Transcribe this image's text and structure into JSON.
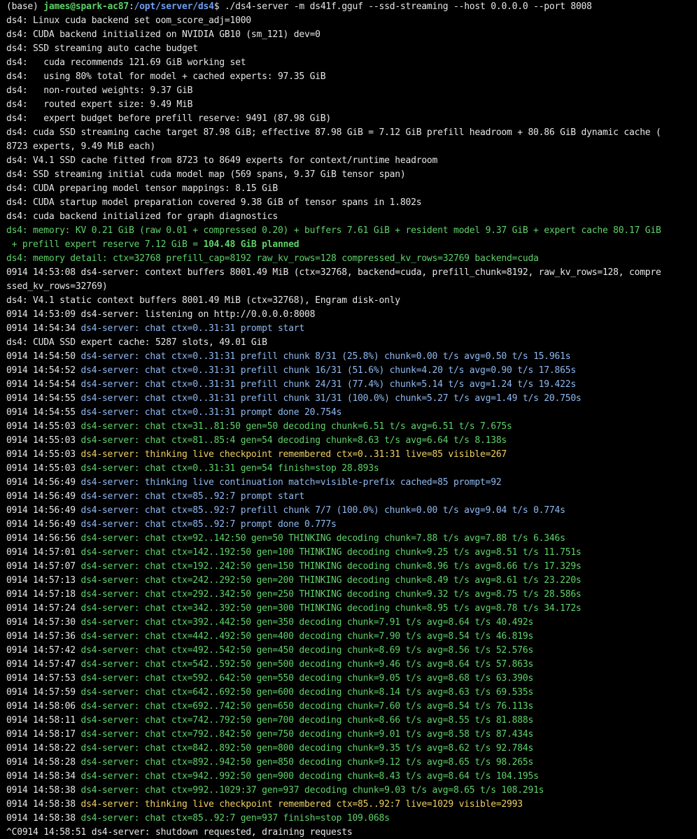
{
  "colors": {
    "background": "#000000",
    "default": "#e6e6e6",
    "blue": "#8fb8f0",
    "green": "#5fd16a",
    "yellow": "#f0d060",
    "prompt_user": "#5fd16a",
    "prompt_path": "#6f9ff0"
  },
  "lines": [
    [
      [
        "default",
        "(base) "
      ],
      [
        "prompt-user",
        "james@spark-ac87"
      ],
      [
        "default",
        ":"
      ],
      [
        "prompt-path",
        "/opt/server/ds4"
      ],
      [
        "default",
        "$ ./ds4-server -m ds41f.gguf --ssd-streaming --host 0.0.0.0 --port 8008"
      ]
    ],
    [
      [
        "default",
        "ds4: Linux cuda backend set oom_score_adj=1000"
      ]
    ],
    [
      [
        "default",
        "ds4: CUDA backend initialized on NVIDIA GB10 (sm_121) dev=0"
      ]
    ],
    [
      [
        "default",
        "ds4: SSD streaming auto cache budget"
      ]
    ],
    [
      [
        "default",
        "ds4:   cuda recommends 121.69 GiB working set"
      ]
    ],
    [
      [
        "default",
        "ds4:   using 80% total for model + cached experts: 97.35 GiB"
      ]
    ],
    [
      [
        "default",
        "ds4:   non-routed weights: 9.37 GiB"
      ]
    ],
    [
      [
        "default",
        "ds4:   routed expert size: 9.49 MiB"
      ]
    ],
    [
      [
        "default",
        "ds4:   expert budget before prefill reserve: 9491 (87.98 GiB)"
      ]
    ],
    [
      [
        "default",
        "ds4: cuda SSD streaming cache target 87.98 GiB; effective 87.98 GiB = 7.12 GiB prefill headroom + 80.86 GiB dynamic cache ("
      ]
    ],
    [
      [
        "default",
        "8723 experts, 9.49 MiB each)"
      ]
    ],
    [
      [
        "default",
        "ds4: V4.1 SSD cache fitted from 8723 to 8649 experts for context/runtime headroom"
      ]
    ],
    [
      [
        "default",
        "ds4: SSD streaming initial cuda model map (569 spans, 9.37 GiB tensor span)"
      ]
    ],
    [
      [
        "default",
        "ds4: CUDA preparing model tensor mappings: 8.15 GiB"
      ]
    ],
    [
      [
        "default",
        "ds4: CUDA startup model preparation covered 9.38 GiB of tensor spans in 1.802s"
      ]
    ],
    [
      [
        "default",
        "ds4: cuda backend initialized for graph diagnostics"
      ]
    ],
    [
      [
        "green",
        "ds4: memory: KV 0.21 GiB (raw 0.01 + compressed 0.20) + buffers 7.61 GiB + resident model 9.37 GiB + expert cache 80.17 GiB"
      ]
    ],
    [
      [
        "green",
        " + prefill expert reserve 7.12 GiB = "
      ],
      [
        "green-bold",
        "104.48 GiB planned"
      ]
    ],
    [
      [
        "green",
        "ds4: memory detail: ctx=32768 prefill_cap=8192 raw_kv_rows=128 compressed_kv_rows=32769 backend=cuda"
      ]
    ],
    [
      [
        "default",
        "0914 14:53:08 ds4-server: context buffers 8001.49 MiB (ctx=32768, backend=cuda, prefill_chunk=8192, raw_kv_rows=128, compre"
      ]
    ],
    [
      [
        "default",
        "ssed_kv_rows=32769)"
      ]
    ],
    [
      [
        "default",
        "ds4: V4.1 static context buffers 8001.49 MiB (ctx=32768), Engram disk-only"
      ]
    ],
    [
      [
        "default",
        "0914 14:53:09 ds4-server: listening on http://0.0.0.0:8008"
      ]
    ],
    [
      [
        "default",
        "0914 14:54:34 "
      ],
      [
        "blue",
        "ds4-server: chat ctx=0..31:31 prompt start"
      ]
    ],
    [
      [
        "default",
        "ds4: CUDA SSD expert cache: 5287 slots, 49.01 GiB"
      ]
    ],
    [
      [
        "default",
        "0914 14:54:50 "
      ],
      [
        "blue",
        "ds4-server: chat ctx=0..31:31 prefill chunk 8/31 (25.8%) chunk=0.00 t/s avg=0.50 t/s 15.961s"
      ]
    ],
    [
      [
        "default",
        "0914 14:54:52 "
      ],
      [
        "blue",
        "ds4-server: chat ctx=0..31:31 prefill chunk 16/31 (51.6%) chunk=4.20 t/s avg=0.90 t/s 17.865s"
      ]
    ],
    [
      [
        "default",
        "0914 14:54:54 "
      ],
      [
        "blue",
        "ds4-server: chat ctx=0..31:31 prefill chunk 24/31 (77.4%) chunk=5.14 t/s avg=1.24 t/s 19.422s"
      ]
    ],
    [
      [
        "default",
        "0914 14:54:55 "
      ],
      [
        "blue",
        "ds4-server: chat ctx=0..31:31 prefill chunk 31/31 (100.0%) chunk=5.27 t/s avg=1.49 t/s 20.750s"
      ]
    ],
    [
      [
        "default",
        "0914 14:54:55 "
      ],
      [
        "blue",
        "ds4-server: chat ctx=0..31:31 prompt done 20.754s"
      ]
    ],
    [
      [
        "default",
        "0914 14:55:03 "
      ],
      [
        "green",
        "ds4-server: chat ctx=31..81:50 gen=50 decoding chunk=6.51 t/s avg=6.51 t/s 7.675s"
      ]
    ],
    [
      [
        "default",
        "0914 14:55:03 "
      ],
      [
        "green",
        "ds4-server: chat ctx=81..85:4 gen=54 decoding chunk=8.63 t/s avg=6.64 t/s 8.138s"
      ]
    ],
    [
      [
        "default",
        "0914 14:55:03 "
      ],
      [
        "yellow",
        "ds4-server: thinking live checkpoint remembered ctx=0..31:31 live=85 visible=267"
      ]
    ],
    [
      [
        "default",
        "0914 14:55:03 "
      ],
      [
        "green",
        "ds4-server: chat ctx=0..31:31 gen=54 finish=stop 28.893s"
      ]
    ],
    [
      [
        "default",
        "0914 14:56:49 "
      ],
      [
        "blue",
        "ds4-server: thinking live continuation match=visible-prefix cached=85 prompt=92"
      ]
    ],
    [
      [
        "default",
        "0914 14:56:49 "
      ],
      [
        "blue",
        "ds4-server: chat ctx=85..92:7 prompt start"
      ]
    ],
    [
      [
        "default",
        "0914 14:56:49 "
      ],
      [
        "blue",
        "ds4-server: chat ctx=85..92:7 prefill chunk 7/7 (100.0%) chunk=0.00 t/s avg=9.04 t/s 0.774s"
      ]
    ],
    [
      [
        "default",
        "0914 14:56:49 "
      ],
      [
        "blue",
        "ds4-server: chat ctx=85..92:7 prompt done 0.777s"
      ]
    ],
    [
      [
        "default",
        "0914 14:56:56 "
      ],
      [
        "green",
        "ds4-server: chat ctx=92..142:50 gen=50 THINKING decoding chunk=7.88 t/s avg=7.88 t/s 6.346s"
      ]
    ],
    [
      [
        "default",
        "0914 14:57:01 "
      ],
      [
        "green",
        "ds4-server: chat ctx=142..192:50 gen=100 THINKING decoding chunk=9.25 t/s avg=8.51 t/s 11.751s"
      ]
    ],
    [
      [
        "default",
        "0914 14:57:07 "
      ],
      [
        "green",
        "ds4-server: chat ctx=192..242:50 gen=150 THINKING decoding chunk=8.96 t/s avg=8.66 t/s 17.329s"
      ]
    ],
    [
      [
        "default",
        "0914 14:57:13 "
      ],
      [
        "green",
        "ds4-server: chat ctx=242..292:50 gen=200 THINKING decoding chunk=8.49 t/s avg=8.61 t/s 23.220s"
      ]
    ],
    [
      [
        "default",
        "0914 14:57:18 "
      ],
      [
        "green",
        "ds4-server: chat ctx=292..342:50 gen=250 THINKING decoding chunk=9.32 t/s avg=8.75 t/s 28.586s"
      ]
    ],
    [
      [
        "default",
        "0914 14:57:24 "
      ],
      [
        "green",
        "ds4-server: chat ctx=342..392:50 gen=300 THINKING decoding chunk=8.95 t/s avg=8.78 t/s 34.172s"
      ]
    ],
    [
      [
        "default",
        "0914 14:57:30 "
      ],
      [
        "green",
        "ds4-server: chat ctx=392..442:50 gen=350 decoding chunk=7.91 t/s avg=8.64 t/s 40.492s"
      ]
    ],
    [
      [
        "default",
        "0914 14:57:36 "
      ],
      [
        "green",
        "ds4-server: chat ctx=442..492:50 gen=400 decoding chunk=7.90 t/s avg=8.54 t/s 46.819s"
      ]
    ],
    [
      [
        "default",
        "0914 14:57:42 "
      ],
      [
        "green",
        "ds4-server: chat ctx=492..542:50 gen=450 decoding chunk=8.69 t/s avg=8.56 t/s 52.576s"
      ]
    ],
    [
      [
        "default",
        "0914 14:57:47 "
      ],
      [
        "green",
        "ds4-server: chat ctx=542..592:50 gen=500 decoding chunk=9.46 t/s avg=8.64 t/s 57.863s"
      ]
    ],
    [
      [
        "default",
        "0914 14:57:53 "
      ],
      [
        "green",
        "ds4-server: chat ctx=592..642:50 gen=550 decoding chunk=9.05 t/s avg=8.68 t/s 63.390s"
      ]
    ],
    [
      [
        "default",
        "0914 14:57:59 "
      ],
      [
        "green",
        "ds4-server: chat ctx=642..692:50 gen=600 decoding chunk=8.14 t/s avg=8.63 t/s 69.535s"
      ]
    ],
    [
      [
        "default",
        "0914 14:58:06 "
      ],
      [
        "green",
        "ds4-server: chat ctx=692..742:50 gen=650 decoding chunk=7.60 t/s avg=8.54 t/s 76.113s"
      ]
    ],
    [
      [
        "default",
        "0914 14:58:11 "
      ],
      [
        "green",
        "ds4-server: chat ctx=742..792:50 gen=700 decoding chunk=8.66 t/s avg=8.55 t/s 81.888s"
      ]
    ],
    [
      [
        "default",
        "0914 14:58:17 "
      ],
      [
        "green",
        "ds4-server: chat ctx=792..842:50 gen=750 decoding chunk=9.01 t/s avg=8.58 t/s 87.434s"
      ]
    ],
    [
      [
        "default",
        "0914 14:58:22 "
      ],
      [
        "green",
        "ds4-server: chat ctx=842..892:50 gen=800 decoding chunk=9.35 t/s avg=8.62 t/s 92.784s"
      ]
    ],
    [
      [
        "default",
        "0914 14:58:28 "
      ],
      [
        "green",
        "ds4-server: chat ctx=892..942:50 gen=850 decoding chunk=9.12 t/s avg=8.65 t/s 98.265s"
      ]
    ],
    [
      [
        "default",
        "0914 14:58:34 "
      ],
      [
        "green",
        "ds4-server: chat ctx=942..992:50 gen=900 decoding chunk=8.43 t/s avg=8.64 t/s 104.195s"
      ]
    ],
    [
      [
        "default",
        "0914 14:58:38 "
      ],
      [
        "green",
        "ds4-server: chat ctx=992..1029:37 gen=937 decoding chunk=9.03 t/s avg=8.65 t/s 108.291s"
      ]
    ],
    [
      [
        "default",
        "0914 14:58:38 "
      ],
      [
        "yellow",
        "ds4-server: thinking live checkpoint remembered ctx=85..92:7 live=1029 visible=2993"
      ]
    ],
    [
      [
        "default",
        "0914 14:58:38 "
      ],
      [
        "green",
        "ds4-server: chat ctx=85..92:7 gen=937 finish=stop 109.068s"
      ]
    ],
    [
      [
        "default",
        "^C0914 14:58:51 ds4-server: shutdown requested, draining requests"
      ]
    ]
  ]
}
